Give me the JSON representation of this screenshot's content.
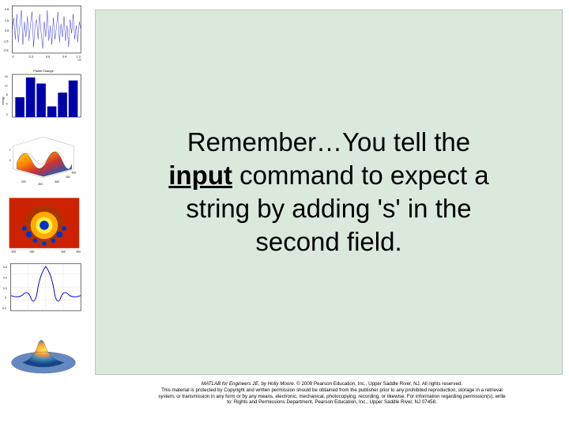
{
  "main": {
    "line1": "Remember…You tell the",
    "bold_word": "input",
    "line2_rest": " command to expect a",
    "line3": "string by adding 's' in the",
    "line4": "second field."
  },
  "footer": {
    "line1a": "MATLAB for Engineers 2E, by Holly Moore. ",
    "line1b": "© 2009 Pearson Education, Inc., Upper Saddle River, NJ.  All rights reserved.",
    "line2": "This material is protected by Copyright and written permission should be obtained from the publisher prior to any prohibited reproduction, storage in a retrieval",
    "line3": "system, or transmission in any form or by any means, electronic, mechanical, photocopying, recording, or likewise. For information regarding permission(s), write",
    "line4": "to: Rights and Permissions Department, Pearson Education, Inc., Upper Saddle River, NJ 07458."
  },
  "thumbs": {
    "t1_title": "",
    "t2_title": "Planet Change",
    "t3_title": "",
    "t4_title": "",
    "t5_title": "",
    "t6_title": ""
  }
}
